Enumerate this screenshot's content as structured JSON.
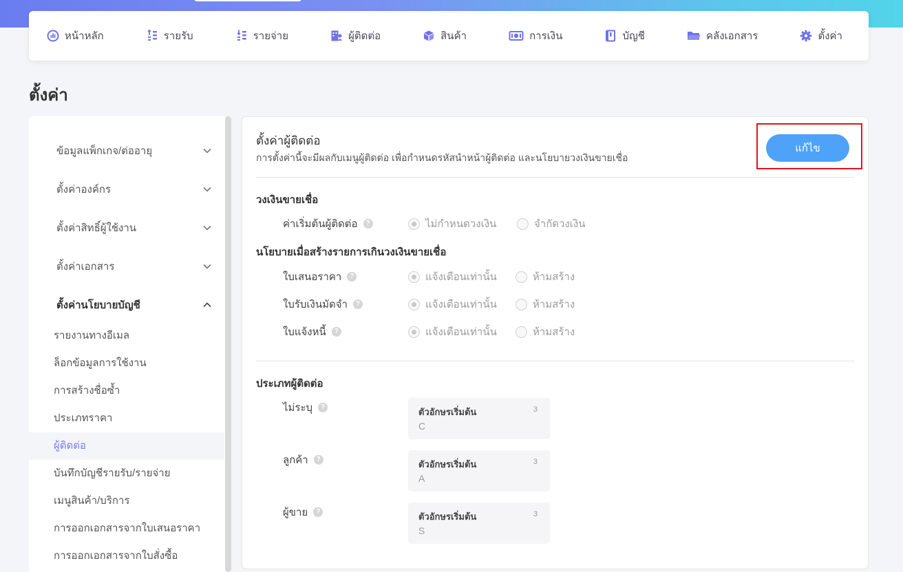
{
  "nav": {
    "items": [
      {
        "label": "หน้าหลัก",
        "icon": "dashboard-icon"
      },
      {
        "label": "รายรับ",
        "icon": "income-icon"
      },
      {
        "label": "รายจ่าย",
        "icon": "expense-icon"
      },
      {
        "label": "ผู้ติดต่อ",
        "icon": "contacts-icon"
      },
      {
        "label": "สินค้า",
        "icon": "box-icon"
      },
      {
        "label": "การเงิน",
        "icon": "money-icon"
      },
      {
        "label": "บัญชี",
        "icon": "ledger-icon"
      },
      {
        "label": "คลังเอกสาร",
        "icon": "folder-icon"
      },
      {
        "label": "ตั้งค่า",
        "icon": "gear-icon"
      }
    ]
  },
  "page": {
    "title": "ตั้งค่า"
  },
  "sidebar": {
    "groups": [
      {
        "label": "ข้อมูลแพ็กเกจ/ต่ออายุ",
        "expanded": false
      },
      {
        "label": "ตั้งค่าองค์กร",
        "expanded": false
      },
      {
        "label": "ตั้งค่าสิทธิ์ผู้ใช้งาน",
        "expanded": false
      },
      {
        "label": "ตั้งค่าเอกสาร",
        "expanded": false
      },
      {
        "label": "ตั้งค่านโยบายบัญชี",
        "expanded": true
      }
    ],
    "sub_items": [
      {
        "label": "รายงานทางอีเมล"
      },
      {
        "label": "ล็อกข้อมูลการใช้งาน"
      },
      {
        "label": "การสร้างชื่อซ้ำ"
      },
      {
        "label": "ประเภทราคา"
      },
      {
        "label": "ผู้ติดต่อ",
        "active": true
      },
      {
        "label": "บันทึกบัญชีรายรับ/รายจ่าย"
      },
      {
        "label": "เมนูสินค้า/บริการ"
      },
      {
        "label": "การออกเอกสารจากใบเสนอราคา"
      },
      {
        "label": "การออกเอกสารจากใบสั่งซื้อ"
      }
    ]
  },
  "panel": {
    "title": "ตั้งค่าผู้ติดต่อ",
    "description": "การตั้งค่านี้จะมีผลกับเมนูผู้ติดต่อ เพื่อกำหนดรหัสนำหน้าผู้ติดต่อ และนโยบายวงเงินขายเชื่อ",
    "edit_label": "แก้ไข",
    "credit_section": {
      "heading": "วงเงินขายเชื่อ",
      "row_label": "ค่าเริ่มต้นผู้ติดต่อ",
      "options": [
        "ไม่กำหนดวงเงิน",
        "จำกัดวงเงิน"
      ],
      "selected": 0
    },
    "policy_section": {
      "heading": "นโยบายเมื่อสร้างรายการเกินวงเงินขายเชื่อ",
      "rows": [
        {
          "label": "ใบเสนอราคา",
          "options": [
            "แจ้งเตือนเท่านั้น",
            "ห้ามสร้าง"
          ],
          "selected": 0
        },
        {
          "label": "ใบรับเงินมัดจำ",
          "options": [
            "แจ้งเตือนเท่านั้น",
            "ห้ามสร้าง"
          ],
          "selected": 0
        },
        {
          "label": "ใบแจ้งหนี้",
          "options": [
            "แจ้งเตือนเท่านั้น",
            "ห้ามสร้าง"
          ],
          "selected": 0
        }
      ]
    },
    "contact_type_section": {
      "heading": "ประเภทผู้ติดต่อ",
      "rows": [
        {
          "label": "ไม่ระบุ",
          "field_label": "ตัวอักษรเริ่มต้น",
          "count": "3",
          "value": "C"
        },
        {
          "label": "ลูกค้า",
          "field_label": "ตัวอักษรเริ่มต้น",
          "count": "3",
          "value": "A"
        },
        {
          "label": "ผู้ขาย",
          "field_label": "ตัวอักษรเริ่มต้น",
          "count": "3",
          "value": "S"
        }
      ]
    },
    "help_glyph": "?"
  },
  "colors": {
    "accent": "#7b7df0",
    "button": "#4ea3f8",
    "highlight_box": "#e0141e"
  }
}
